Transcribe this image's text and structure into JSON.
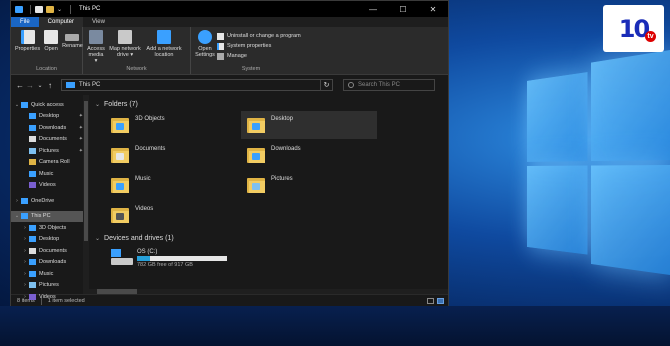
{
  "window": {
    "title": "This PC",
    "controls": {
      "minimize": "—",
      "maximize": "☐",
      "close": "✕"
    }
  },
  "ribbon": {
    "tabs": [
      "File",
      "Computer",
      "View"
    ],
    "groups": {
      "location": {
        "label": "Location",
        "buttons": [
          "Properties",
          "Open",
          "Rename"
        ]
      },
      "network": {
        "label": "Network",
        "buttons": [
          "Access media ▾",
          "Map network drive ▾",
          "Add a network location"
        ]
      },
      "system": {
        "label": "System",
        "open_settings": "Open Settings",
        "items": [
          "Uninstall or change a program",
          "System properties",
          "Manage"
        ]
      }
    }
  },
  "address": {
    "back": "←",
    "forward": "→",
    "up_dropdown": "⌄",
    "up": "↑",
    "path": "This PC",
    "refresh": "↻",
    "search_placeholder": "Search This PC"
  },
  "nav": {
    "items": [
      {
        "label": "Quick access",
        "chev": "⌄",
        "indent": false,
        "icon": "star-icon",
        "color": "#3aa0ff",
        "pinned": false,
        "selected": false
      },
      {
        "label": "Desktop",
        "chev": "",
        "indent": true,
        "icon": "desktop-icon",
        "color": "#3aa0ff",
        "pinned": true,
        "selected": false
      },
      {
        "label": "Downloads",
        "chev": "",
        "indent": true,
        "icon": "download-icon",
        "color": "#3aa0ff",
        "pinned": true,
        "selected": false
      },
      {
        "label": "Documents",
        "chev": "",
        "indent": true,
        "icon": "document-icon",
        "color": "#dddddd",
        "pinned": true,
        "selected": false
      },
      {
        "label": "Pictures",
        "chev": "",
        "indent": true,
        "icon": "picture-icon",
        "color": "#7ec0f0",
        "pinned": true,
        "selected": false
      },
      {
        "label": "Camera Roll",
        "chev": "",
        "indent": true,
        "icon": "folder-icon",
        "color": "#e0b445",
        "pinned": false,
        "selected": false
      },
      {
        "label": "Music",
        "chev": "",
        "indent": true,
        "icon": "music-icon",
        "color": "#3aa0ff",
        "pinned": false,
        "selected": false
      },
      {
        "label": "Videos",
        "chev": "",
        "indent": true,
        "icon": "video-icon",
        "color": "#7a5fd0",
        "pinned": false,
        "selected": false
      },
      {
        "label": "",
        "chev": "",
        "indent": false,
        "icon": "",
        "color": "",
        "pinned": false,
        "selected": false
      },
      {
        "label": "OneDrive",
        "chev": "›",
        "indent": false,
        "icon": "cloud-icon",
        "color": "#3aa0ff",
        "pinned": false,
        "selected": false
      },
      {
        "label": "",
        "chev": "",
        "indent": false,
        "icon": "",
        "color": "",
        "pinned": false,
        "selected": false
      },
      {
        "label": "This PC",
        "chev": "⌄",
        "indent": false,
        "icon": "pc-icon",
        "color": "#3aa0ff",
        "pinned": false,
        "selected": true
      },
      {
        "label": "3D Objects",
        "chev": "›",
        "indent": true,
        "icon": "cube-icon",
        "color": "#3aa0ff",
        "pinned": false,
        "selected": false
      },
      {
        "label": "Desktop",
        "chev": "›",
        "indent": true,
        "icon": "desktop-icon",
        "color": "#3aa0ff",
        "pinned": false,
        "selected": false
      },
      {
        "label": "Documents",
        "chev": "›",
        "indent": true,
        "icon": "document-icon",
        "color": "#dddddd",
        "pinned": false,
        "selected": false
      },
      {
        "label": "Downloads",
        "chev": "›",
        "indent": true,
        "icon": "download-icon",
        "color": "#3aa0ff",
        "pinned": false,
        "selected": false
      },
      {
        "label": "Music",
        "chev": "›",
        "indent": true,
        "icon": "music-icon",
        "color": "#3aa0ff",
        "pinned": false,
        "selected": false
      },
      {
        "label": "Pictures",
        "chev": "›",
        "indent": true,
        "icon": "picture-icon",
        "color": "#7ec0f0",
        "pinned": false,
        "selected": false
      },
      {
        "label": "Videos",
        "chev": "›",
        "indent": true,
        "icon": "video-icon",
        "color": "#7a5fd0",
        "pinned": false,
        "selected": false
      }
    ]
  },
  "content": {
    "folders_header": "Folders (7)",
    "folders": [
      {
        "label": "3D Objects",
        "badge": "#3aa0ff",
        "selected": false
      },
      {
        "label": "Desktop",
        "badge": "#3aa0ff",
        "selected": true
      },
      {
        "label": "Documents",
        "badge": "#e6e6e6",
        "selected": false
      },
      {
        "label": "Downloads",
        "badge": "#3aa0ff",
        "selected": false
      },
      {
        "label": "Music",
        "badge": "#3aa0ff",
        "selected": false
      },
      {
        "label": "Pictures",
        "badge": "#7ec0f0",
        "selected": false
      },
      {
        "label": "Videos",
        "badge": "#555555",
        "selected": false
      }
    ],
    "devices_header": "Devices and drives (1)",
    "drive": {
      "name": "OS (C:)",
      "free_text": "782 GB free of 917 GB",
      "used_fraction": 0.147
    }
  },
  "status": {
    "items": "8 items",
    "selected": "1 item selected"
  },
  "brand": {
    "logo": "10",
    "badge": "tv"
  }
}
